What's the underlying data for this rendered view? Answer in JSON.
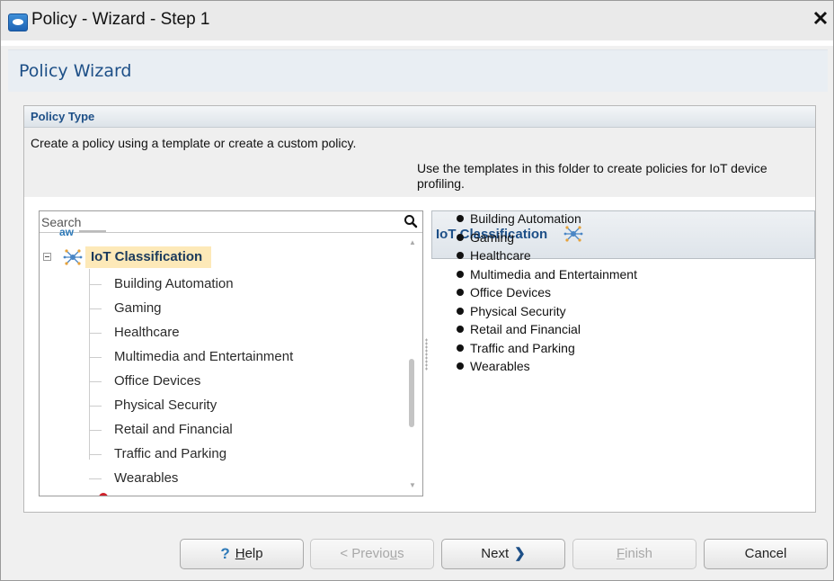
{
  "window": {
    "title": "Policy - Wizard - Step 1",
    "close_glyph": "✕"
  },
  "wizard": {
    "title": "Policy Wizard"
  },
  "section": {
    "title": "Policy Type",
    "description": "Create a policy using a template or create a custom policy."
  },
  "tree": {
    "search_placeholder": "Search",
    "root": {
      "label": "IoT Classification",
      "icon": "hub-icon"
    },
    "items": [
      {
        "label": "Building Automation"
      },
      {
        "label": "Gaming"
      },
      {
        "label": "Healthcare"
      },
      {
        "label": "Multimedia and Entertainment"
      },
      {
        "label": "Office Devices"
      },
      {
        "label": "Physical Security"
      },
      {
        "label": "Retail and Financial"
      },
      {
        "label": "Traffic and Parking"
      },
      {
        "label": "Wearables"
      }
    ]
  },
  "detail": {
    "title": "IoT Classification",
    "description": "Use the templates in this folder to create policies for IoT device profiling.",
    "list": [
      "Building Automation",
      "Gaming",
      "Healthcare",
      "Multimedia and Entertainment",
      "Office Devices",
      "Physical Security",
      "Retail and Financial",
      "Traffic and Parking",
      "Wearables"
    ]
  },
  "buttons": {
    "help": {
      "label_pre": "",
      "label_ul": "H",
      "label_post": "elp"
    },
    "previous": {
      "label_pre": "< Previo",
      "label_ul": "u",
      "label_post": "s"
    },
    "next": {
      "label": "Next",
      "arrow": "❯"
    },
    "finish": {
      "label_pre": "",
      "label_ul": "F",
      "label_post": "inish"
    },
    "cancel": {
      "label": "Cancel"
    }
  },
  "colors": {
    "accent_blue": "#1d4f87",
    "selection_bg": "#fde9b8"
  }
}
